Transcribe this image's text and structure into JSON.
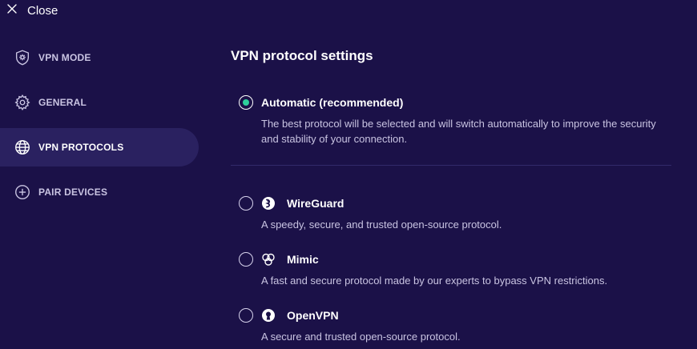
{
  "header": {
    "close_label": "Close"
  },
  "sidebar": {
    "items": [
      {
        "label": "VPN MODE",
        "icon": "shield-gear-icon",
        "active": false
      },
      {
        "label": "GENERAL",
        "icon": "gear-icon",
        "active": false
      },
      {
        "label": "VPN PROTOCOLS",
        "icon": "globe-icon",
        "active": true
      },
      {
        "label": "PAIR DEVICES",
        "icon": "plus-circle-icon",
        "active": false
      }
    ]
  },
  "main": {
    "title": "VPN protocol settings",
    "options": [
      {
        "title": "Automatic (recommended)",
        "description": "The best protocol will be selected and will switch automatically to improve the security and stability of your connection.",
        "selected": true,
        "icon": ""
      },
      {
        "title": "WireGuard",
        "description": "A speedy, secure, and trusted open-source protocol.",
        "selected": false,
        "icon": "wireguard-icon"
      },
      {
        "title": "Mimic",
        "description": "A fast and secure protocol made by our experts to bypass VPN restrictions.",
        "selected": false,
        "icon": "mimic-icon"
      },
      {
        "title": "OpenVPN",
        "description": "A secure and trusted open-source protocol.",
        "selected": false,
        "icon": "openvpn-icon"
      }
    ]
  },
  "colors": {
    "background": "#1b1148",
    "active_nav": "#2a2160",
    "radio_selected": "#2fd09c",
    "text_secondary": "#c9c4e2"
  }
}
